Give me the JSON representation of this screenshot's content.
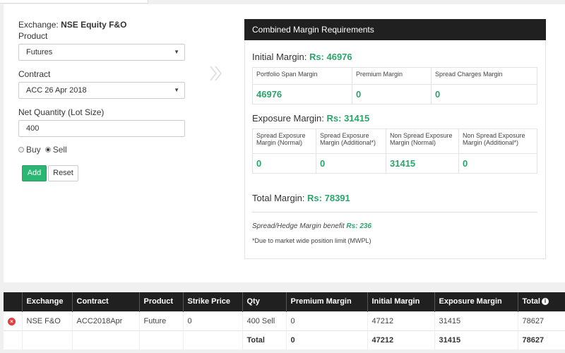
{
  "form": {
    "exchange_label": "Exchange:",
    "exchange_value": "NSE Equity F&O",
    "product_label": "Product",
    "product_value": "Futures",
    "contract_label": "Contract",
    "contract_value": "ACC 26 Apr 2018",
    "qty_label": "Net Quantity (Lot Size)",
    "qty_value": "400",
    "buy_label": "Buy",
    "sell_label": "Sell",
    "selected_side": "Sell",
    "add_label": "Add",
    "reset_label": "Reset"
  },
  "margin": {
    "header": "Combined Margin Requirements",
    "initial_label": "Initial Margin:",
    "initial_amount": "Rs: 46976",
    "initial_cols": [
      {
        "label": "Portfolio Span Margin",
        "value": "46976"
      },
      {
        "label": "Premium Margin",
        "value": "0"
      },
      {
        "label": "Spread Charges Margin",
        "value": "0"
      }
    ],
    "exposure_label": "Exposure Margin:",
    "exposure_amount": "Rs: 31415",
    "exposure_cols": [
      {
        "label": "Spread Exposure Margin (Normal)",
        "value": "0"
      },
      {
        "label": "Spread Exposure Margin (Additional*)",
        "value": "0"
      },
      {
        "label": "Non Spread Exposure Margin (Normal)",
        "value": "31415"
      },
      {
        "label": "Non Spread Exposure Margin (Additional*)",
        "value": "0"
      }
    ],
    "total_label": "Total Margin:",
    "total_amount": "Rs: 78391",
    "benefit_label": "Spread/Hedge Margin benefit",
    "benefit_amount": "Rs: 236",
    "mwpl_note": "*Due to market wide position limit (MWPL)"
  },
  "positions": {
    "headers": [
      "",
      "Exchange",
      "Contract",
      "Product",
      "Strike Price",
      "Qty",
      "Premium Margin",
      "Initial Margin",
      "Exposure Margin",
      "Total"
    ],
    "rows": [
      [
        "",
        "NSE F&O",
        "ACC2018Apr",
        "Future",
        "0",
        "400 Sell",
        "0",
        "47212",
        "31415",
        "78627"
      ]
    ],
    "total_row": [
      "",
      "",
      "",
      "",
      "",
      "Total",
      "0",
      "47212",
      "31415",
      "78627"
    ]
  },
  "colors": {
    "accent_green": "#2aa56a",
    "header_dark": "#202020",
    "remove_red": "#e04040"
  }
}
